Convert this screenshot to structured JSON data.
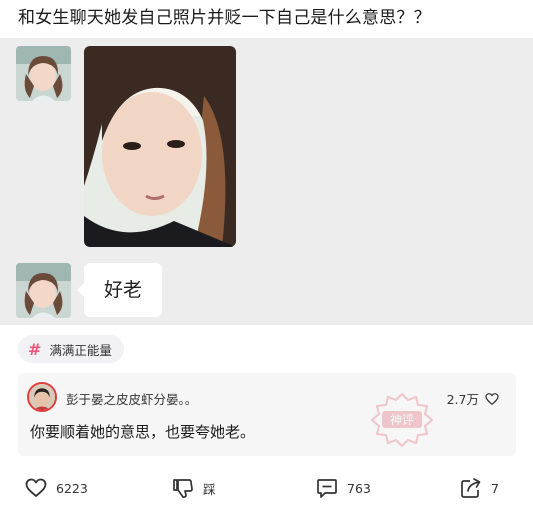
{
  "post": {
    "title": "和女生聊天她发自己照片并贬一下自己是什么意思？？"
  },
  "chat": {
    "message_text": "好老"
  },
  "topic": {
    "icon": "hash-icon",
    "label": "满满正能量"
  },
  "comment": {
    "username": "彭于晏之皮皮虾分晏。。",
    "text": "你要顺着她的意思，也要夸她老。",
    "likes": "2.7万",
    "stamp_text": "神评"
  },
  "actions": {
    "like_count": "6223",
    "dislike_label": "踩",
    "comment_count": "763",
    "share_count": "7"
  },
  "colors": {
    "accent_pink": "#f0567a",
    "chat_background": "#ededed",
    "stamp_red": "#e58a93"
  }
}
